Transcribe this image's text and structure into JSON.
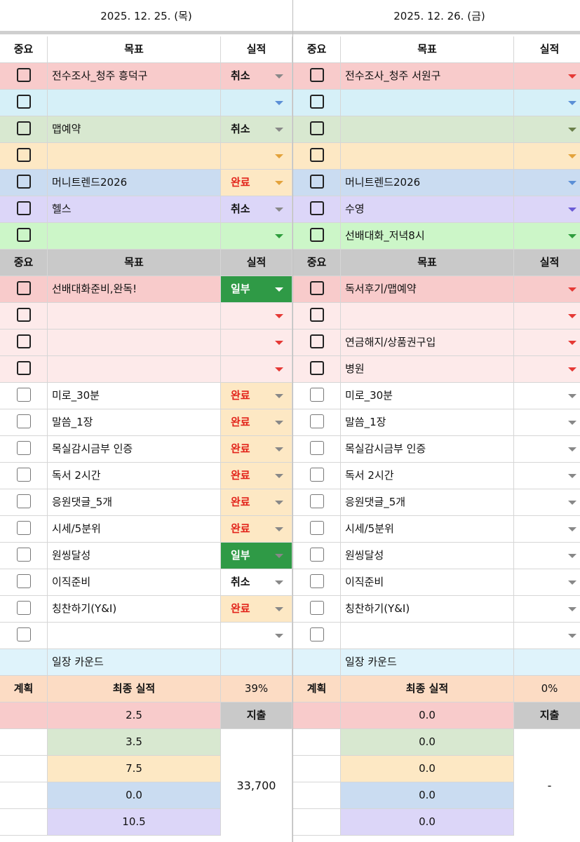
{
  "colors": {
    "pink": "#f8cbcb",
    "cyan": "#d6f0f8",
    "green_soft": "#d8e8d0",
    "yellow": "#fde8c4",
    "blue": "#cadcf1",
    "purple": "#dcd6f8",
    "lime": "#ccf6c8",
    "header_gray": "#c9c9c9",
    "rose": "#fdeaea",
    "white": "#ffffff",
    "count_cyan": "#dff3fb",
    "plan_peach": "#fcdcc4",
    "tri_red": "#e53935",
    "tri_blue": "#5b8fd6",
    "tri_green": "#2e9d3d",
    "tri_olive": "#6a7f4a",
    "tri_orange": "#e3a23b",
    "tri_purple": "#6b5bd6",
    "tri_gray": "#888888",
    "status_red_text": "#e2231a",
    "status_yellow_bg": "#fde8c4",
    "status_green_bg": "#2f9a46"
  },
  "days": [
    {
      "date": "2025. 12. 25. (목)",
      "header_labels": [
        "중요",
        "목표",
        "실적"
      ],
      "top_rows": [
        {
          "bg": "pink",
          "goal": "전수조사_청주 흥덕구",
          "status": "취소",
          "status_style": "plain",
          "tri": "tri_gray",
          "icon": "checkbox-icon"
        },
        {
          "bg": "cyan",
          "goal": "",
          "status": "",
          "status_style": "plain",
          "tri": "tri_blue",
          "icon": "checkbox-icon"
        },
        {
          "bg": "green_soft",
          "goal": "맵예약",
          "status": "취소",
          "status_style": "plain",
          "tri": "tri_gray",
          "icon": "checkbox-icon"
        },
        {
          "bg": "yellow",
          "goal": "",
          "status": "",
          "status_style": "plain",
          "tri": "tri_orange",
          "icon": "checkbox-icon"
        },
        {
          "bg": "blue",
          "goal": "머니트렌드2026",
          "status": "완료",
          "status_style": "done",
          "tri": "tri_orange",
          "icon": "checkbox-icon"
        },
        {
          "bg": "purple",
          "goal": "헬스",
          "status": "취소",
          "status_style": "plain",
          "tri": "tri_gray",
          "icon": "checkbox-icon"
        },
        {
          "bg": "lime",
          "goal": "",
          "status": "",
          "status_style": "plain",
          "tri": "tri_green",
          "icon": "checkbox-icon"
        }
      ],
      "mid_rows": [
        {
          "bg": "pink",
          "goal": "선배대화준비,완독!",
          "status": "일부",
          "status_style": "partial",
          "tri": "tri_white",
          "icon": "checkbox-icon"
        },
        {
          "bg": "rose",
          "goal": "",
          "status": "",
          "status_style": "plain",
          "tri": "tri_red",
          "icon": "checkbox-icon"
        },
        {
          "bg": "rose",
          "goal": "",
          "status": "",
          "status_style": "plain",
          "tri": "tri_red",
          "icon": "checkbox-icon"
        },
        {
          "bg": "rose",
          "goal": "",
          "status": "",
          "status_style": "plain",
          "tri": "tri_red",
          "icon": "checkbox-icon"
        }
      ],
      "routine_rows": [
        {
          "goal": "미로_30분",
          "status": "완료",
          "status_style": "done"
        },
        {
          "goal": "말씀_1장",
          "status": "완료",
          "status_style": "done"
        },
        {
          "goal": "목실감시금부 인증",
          "status": "완료",
          "status_style": "done"
        },
        {
          "goal": "독서 2시간",
          "status": "완료",
          "status_style": "done"
        },
        {
          "goal": "응원댓글_5개",
          "status": "완료",
          "status_style": "done"
        },
        {
          "goal": "시세/5분위",
          "status": "완료",
          "status_style": "done"
        },
        {
          "goal": "원씽달성",
          "status": "일부",
          "status_style": "partial"
        },
        {
          "goal": "이직준비",
          "status": "취소",
          "status_style": "plain"
        },
        {
          "goal": "칭찬하기(Y&I)",
          "status": "완료",
          "status_style": "done"
        },
        {
          "goal": "",
          "status": "",
          "status_style": "plain"
        }
      ],
      "count_label": "일장 카운드",
      "plan_label": "계획",
      "final_label": "최종 실적",
      "final_pct": "39%",
      "expense_label": "지출",
      "summary_values": [
        "2.5",
        "3.5",
        "7.5",
        "0.0",
        "10.5"
      ],
      "expense_amount": "33,700"
    },
    {
      "date": "2025. 12. 26. (금)",
      "header_labels": [
        "중요",
        "목표",
        "실적"
      ],
      "top_rows": [
        {
          "bg": "pink",
          "goal": "전수조사_청주 서원구",
          "status": "",
          "status_style": "plain",
          "tri": "tri_red",
          "icon": "checkbox-icon"
        },
        {
          "bg": "cyan",
          "goal": "",
          "status": "",
          "status_style": "plain",
          "tri": "tri_blue",
          "icon": "checkbox-icon"
        },
        {
          "bg": "green_soft",
          "goal": "",
          "status": "",
          "status_style": "plain",
          "tri": "tri_olive",
          "icon": "checkbox-icon"
        },
        {
          "bg": "yellow",
          "goal": "",
          "status": "",
          "status_style": "plain",
          "tri": "tri_orange",
          "icon": "checkbox-icon"
        },
        {
          "bg": "blue",
          "goal": "머니트렌드2026",
          "status": "",
          "status_style": "plain",
          "tri": "tri_blue",
          "icon": "checkbox-icon"
        },
        {
          "bg": "purple",
          "goal": "수영",
          "status": "",
          "status_style": "plain",
          "tri": "tri_purple",
          "icon": "checkbox-icon"
        },
        {
          "bg": "lime",
          "goal": "선배대화_저녁8시",
          "status": "",
          "status_style": "plain",
          "tri": "tri_green",
          "icon": "checkbox-icon"
        }
      ],
      "mid_rows": [
        {
          "bg": "pink",
          "goal": "독서후기/맵예약",
          "status": "",
          "status_style": "plain",
          "tri": "tri_red",
          "icon": "checkbox-icon"
        },
        {
          "bg": "rose",
          "goal": "",
          "status": "",
          "status_style": "plain",
          "tri": "tri_red",
          "icon": "checkbox-icon"
        },
        {
          "bg": "rose",
          "goal": "연금해지/상품권구입",
          "status": "",
          "status_style": "plain",
          "tri": "tri_red",
          "icon": "checkbox-icon"
        },
        {
          "bg": "rose",
          "goal": "병원",
          "status": "",
          "status_style": "plain",
          "tri": "tri_red",
          "icon": "checkbox-icon"
        }
      ],
      "routine_rows": [
        {
          "goal": "미로_30분",
          "status": "",
          "status_style": "plain"
        },
        {
          "goal": "말씀_1장",
          "status": "",
          "status_style": "plain"
        },
        {
          "goal": "목실감시금부 인증",
          "status": "",
          "status_style": "plain"
        },
        {
          "goal": "독서 2시간",
          "status": "",
          "status_style": "plain"
        },
        {
          "goal": "응원댓글_5개",
          "status": "",
          "status_style": "plain"
        },
        {
          "goal": "시세/5분위",
          "status": "",
          "status_style": "plain"
        },
        {
          "goal": "원씽달성",
          "status": "",
          "status_style": "plain"
        },
        {
          "goal": "이직준비",
          "status": "",
          "status_style": "plain"
        },
        {
          "goal": "칭찬하기(Y&I)",
          "status": "",
          "status_style": "plain"
        },
        {
          "goal": "",
          "status": "",
          "status_style": "plain"
        }
      ],
      "count_label": "일장 카운드",
      "plan_label": "계획",
      "final_label": "최종 실적",
      "final_pct": "0%",
      "expense_label": "지출",
      "summary_values": [
        "0.0",
        "0.0",
        "0.0",
        "0.0",
        "0.0"
      ],
      "expense_amount": "-"
    }
  ]
}
